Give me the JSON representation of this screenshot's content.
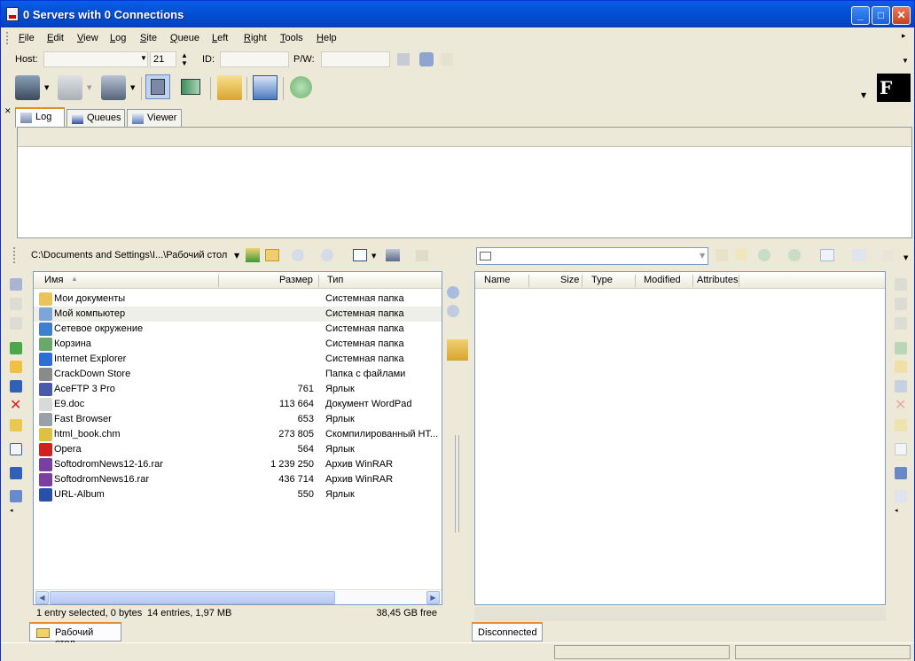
{
  "window": {
    "title": "0 Servers with 0 Connections"
  },
  "menu": [
    "File",
    "Edit",
    "View",
    "Log",
    "Site",
    "Queue",
    "Left",
    "Right",
    "Tools",
    "Help"
  ],
  "connect": {
    "host_label": "Host:",
    "host_value": "",
    "port_value": "21",
    "id_label": "ID:",
    "id_value": "",
    "pw_label": "P/W:",
    "pw_value": ""
  },
  "log_tabs": [
    "Log",
    "Queues",
    "Viewer"
  ],
  "left": {
    "path": "C:\\Documents and Settings\\I...\\Рабочий стол",
    "columns": {
      "name": "Имя",
      "size": "Размер",
      "type": "Тип"
    },
    "files": [
      {
        "name": "Мои документы",
        "size": "",
        "type": "Системная папка",
        "icon": "folder-docs-icon",
        "color": "#e9c45a"
      },
      {
        "name": "Мой компьютер",
        "size": "",
        "type": "Системная папка",
        "icon": "computer-icon",
        "color": "#7ea4d8"
      },
      {
        "name": "Сетевое окружение",
        "size": "",
        "type": "Системная папка",
        "icon": "network-icon",
        "color": "#3f7fd0"
      },
      {
        "name": "Корзина",
        "size": "",
        "type": "Системная папка",
        "icon": "recycle-bin-icon",
        "color": "#6aa86a"
      },
      {
        "name": "Internet Explorer",
        "size": "",
        "type": "Системная папка",
        "icon": "ie-icon",
        "color": "#2d6fd6"
      },
      {
        "name": "CrackDown Store",
        "size": "",
        "type": "Папка с файлами",
        "icon": "gear-folder-icon",
        "color": "#8a8a8a"
      },
      {
        "name": "AceFTP 3 Pro",
        "size": "761",
        "type": "Ярлык",
        "icon": "aceftp-icon",
        "color": "#4a5aa8"
      },
      {
        "name": "E9.doc",
        "size": "113 664",
        "type": "Документ WordPad",
        "icon": "document-icon",
        "color": "#d9d9d9"
      },
      {
        "name": "Fast Browser",
        "size": "653",
        "type": "Ярлык",
        "icon": "browser-icon",
        "color": "#9aa0a8"
      },
      {
        "name": "html_book.chm",
        "size": "273 805",
        "type": "Скомпилированный HT...",
        "icon": "help-file-icon",
        "color": "#e0c040"
      },
      {
        "name": "Opera",
        "size": "564",
        "type": "Ярлык",
        "icon": "opera-icon",
        "color": "#d02020"
      },
      {
        "name": "SoftodromNews12-16.rar",
        "size": "1 239 250",
        "type": "Архив WinRAR",
        "icon": "rar-archive-icon",
        "color": "#7a3fa0"
      },
      {
        "name": "SoftodromNews16.rar",
        "size": "436 714",
        "type": "Архив WinRAR",
        "icon": "rar-archive-icon",
        "color": "#7a3fa0"
      },
      {
        "name": "URL-Album",
        "size": "550",
        "type": "Ярлык",
        "icon": "url-album-icon",
        "color": "#2a4fa8"
      }
    ],
    "status": {
      "selection": "1 entry selected, 0 bytes",
      "entries": "14 entries, 1,97 MB",
      "free": "38,45 GB free"
    },
    "tab": "Рабочий стол"
  },
  "right": {
    "path": "",
    "columns": {
      "name": "Name",
      "size": "Size",
      "type": "Type",
      "modified": "Modified",
      "attributes": "Attributes"
    },
    "tab": "Disconnected"
  }
}
